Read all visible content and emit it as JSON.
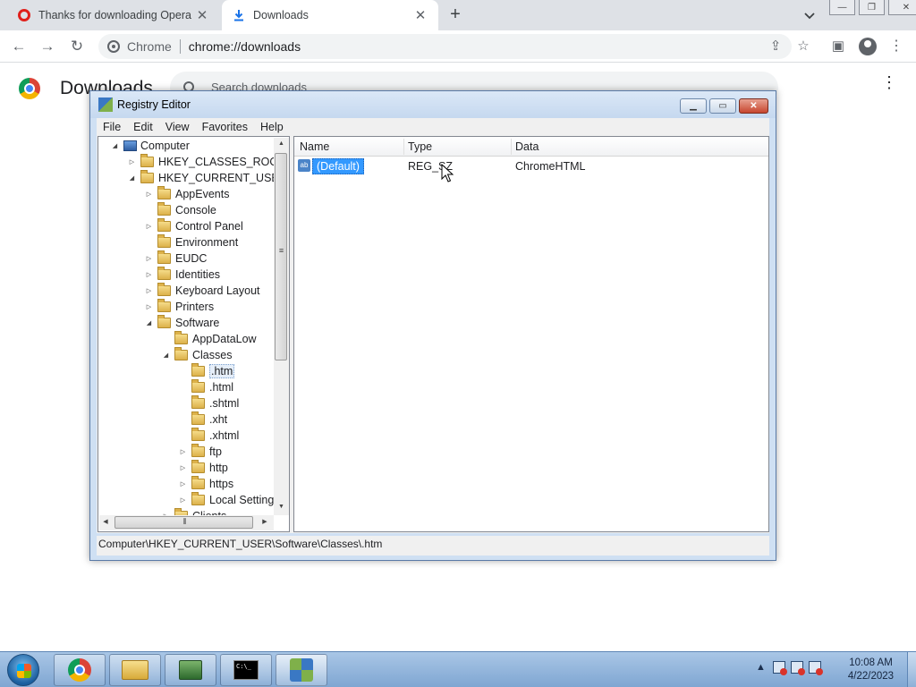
{
  "browser": {
    "tabs": [
      {
        "title": "Thanks for downloading Opera",
        "icon": "opera-icon"
      },
      {
        "title": "Downloads",
        "icon": "download-icon",
        "active": true
      }
    ],
    "omnibox": {
      "chip": "Chrome",
      "url": "chrome://downloads"
    }
  },
  "downloads_page": {
    "title": "Downloads",
    "search_placeholder": "Search downloads"
  },
  "regedit": {
    "title": "Registry Editor",
    "menu": [
      "File",
      "Edit",
      "View",
      "Favorites",
      "Help"
    ],
    "tree": [
      {
        "label": "Computer",
        "level": 0,
        "toggle": "open",
        "icon": "computer-icon"
      },
      {
        "label": "HKEY_CLASSES_ROOT",
        "level": 1,
        "toggle": "closed"
      },
      {
        "label": "HKEY_CURRENT_USER",
        "level": 1,
        "toggle": "open"
      },
      {
        "label": "AppEvents",
        "level": 2,
        "toggle": "closed"
      },
      {
        "label": "Console",
        "level": 2,
        "toggle": "none"
      },
      {
        "label": "Control Panel",
        "level": 2,
        "toggle": "closed"
      },
      {
        "label": "Environment",
        "level": 2,
        "toggle": "none"
      },
      {
        "label": "EUDC",
        "level": 2,
        "toggle": "closed"
      },
      {
        "label": "Identities",
        "level": 2,
        "toggle": "closed"
      },
      {
        "label": "Keyboard Layout",
        "level": 2,
        "toggle": "closed"
      },
      {
        "label": "Printers",
        "level": 2,
        "toggle": "closed"
      },
      {
        "label": "Software",
        "level": 2,
        "toggle": "open"
      },
      {
        "label": "AppDataLow",
        "level": 3,
        "toggle": "none"
      },
      {
        "label": "Classes",
        "level": 3,
        "toggle": "open"
      },
      {
        "label": ".htm",
        "level": 4,
        "toggle": "none",
        "selected": true
      },
      {
        "label": ".html",
        "level": 4,
        "toggle": "none"
      },
      {
        "label": ".shtml",
        "level": 4,
        "toggle": "none"
      },
      {
        "label": ".xht",
        "level": 4,
        "toggle": "none"
      },
      {
        "label": ".xhtml",
        "level": 4,
        "toggle": "none"
      },
      {
        "label": "ftp",
        "level": 4,
        "toggle": "closed"
      },
      {
        "label": "http",
        "level": 4,
        "toggle": "closed"
      },
      {
        "label": "https",
        "level": 4,
        "toggle": "closed"
      },
      {
        "label": "Local Settings",
        "level": 4,
        "toggle": "closed"
      },
      {
        "label": "Clients",
        "level": 3,
        "toggle": "closed"
      }
    ],
    "columns": [
      "Name",
      "Type",
      "Data"
    ],
    "values": [
      {
        "name": "(Default)",
        "type": "REG_SZ",
        "data": "ChromeHTML"
      }
    ],
    "status": "Computer\\HKEY_CURRENT_USER\\Software\\Classes\\.htm"
  },
  "taskbar": {
    "apps": [
      "chrome-icon",
      "explorer-icon",
      "network-icon",
      "cmd-icon",
      "regedit-icon"
    ],
    "clock_time": "10:08 AM",
    "clock_date": "4/22/2023"
  }
}
